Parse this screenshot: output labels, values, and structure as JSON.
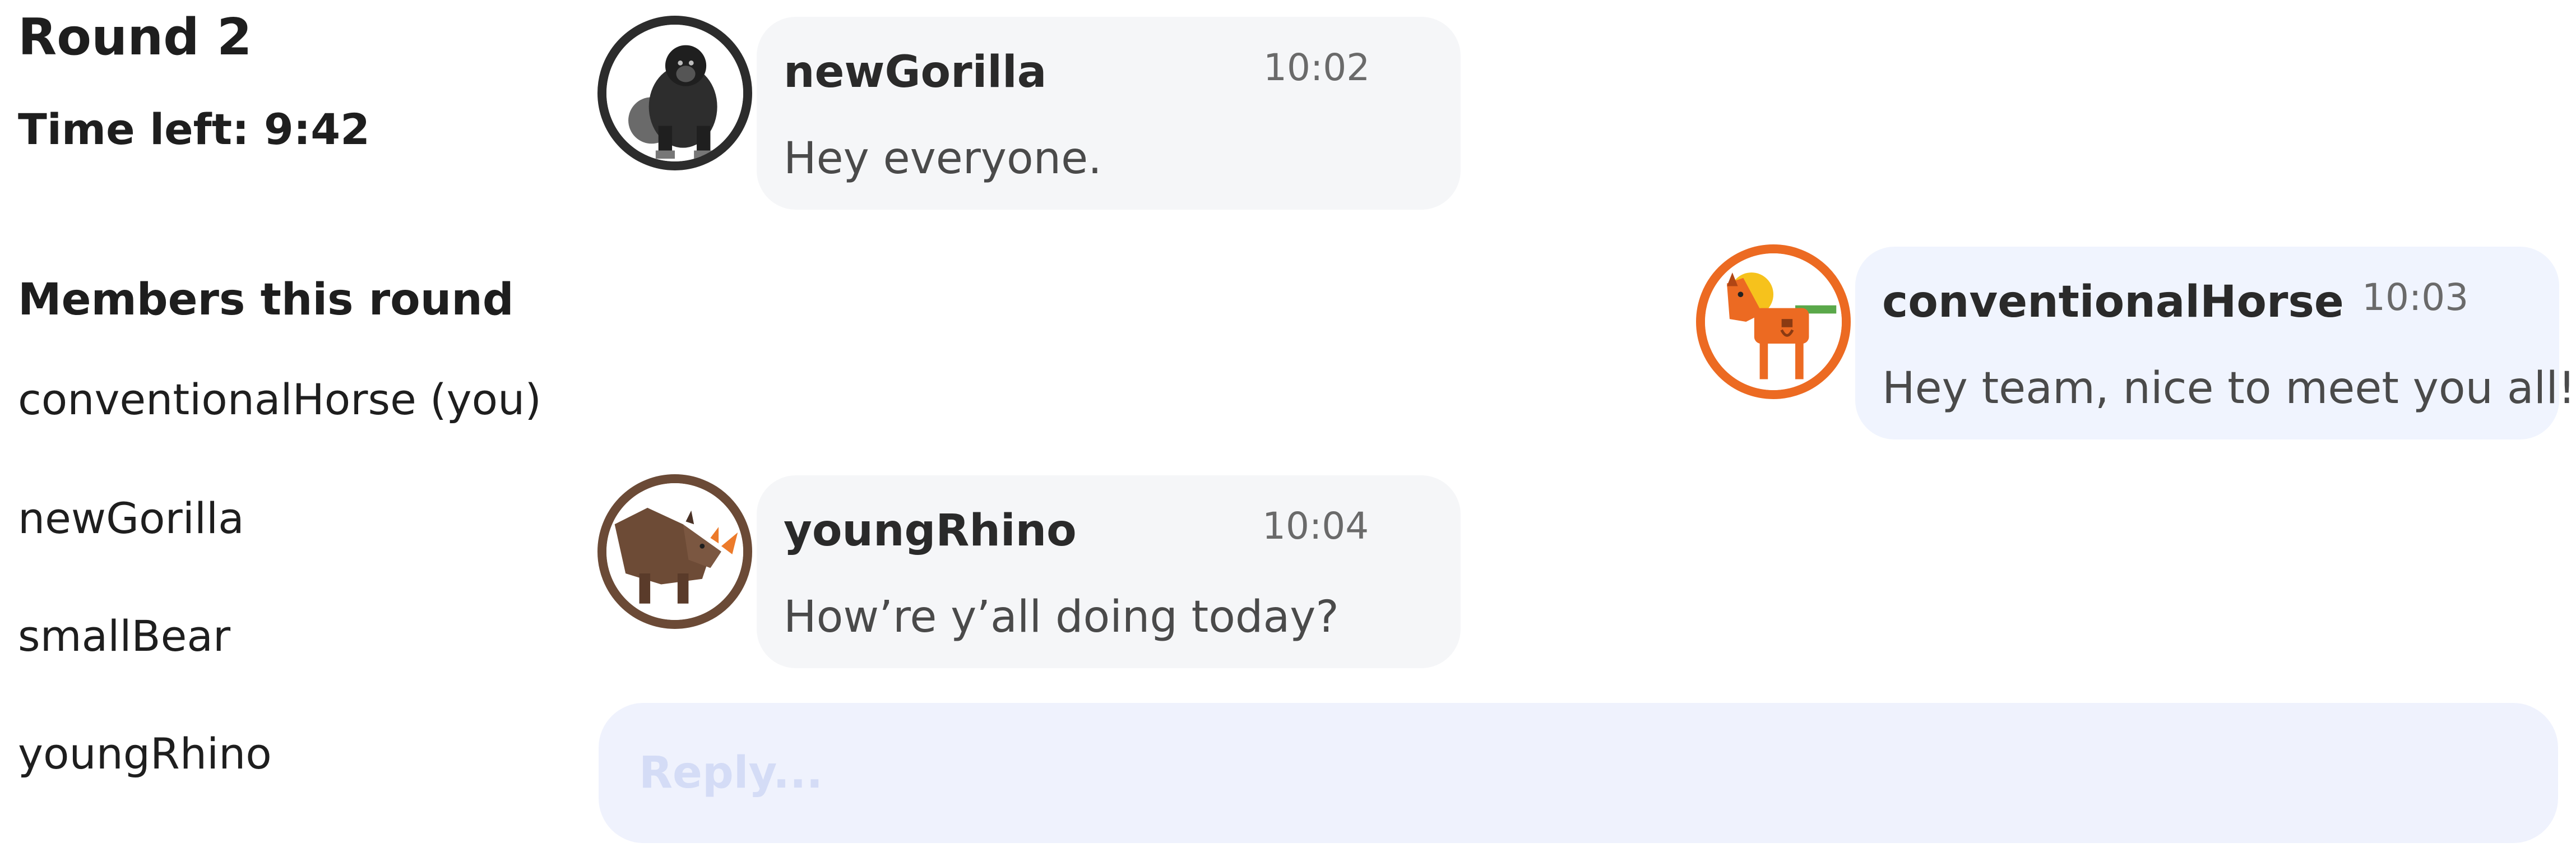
{
  "round": {
    "title": "Round 2",
    "time_left": "Time left: 9:42"
  },
  "members": {
    "heading": "Members this round",
    "items": [
      {
        "label": "conventionalHorse (you)"
      },
      {
        "label": "newGorilla"
      },
      {
        "label": "smallBear"
      },
      {
        "label": "youngRhino"
      }
    ]
  },
  "messages": [
    {
      "sender": "newGorilla",
      "time": "10:02",
      "text": "Hey everyone.",
      "avatar_icon": "gorilla-avatar-icon",
      "ring_color": "#2c2c2c",
      "mine": false
    },
    {
      "sender": "conventionalHorse",
      "time": "10:03",
      "text": "Hey team, nice to meet you all!",
      "avatar_icon": "horse-avatar-icon",
      "ring_color": "#ec6a22",
      "mine": true
    },
    {
      "sender": "youngRhino",
      "time": "10:04",
      "text": "How’re y’all doing today?",
      "avatar_icon": "rhino-avatar-icon",
      "ring_color": "#6b4a36",
      "mine": false
    }
  ],
  "reply": {
    "placeholder": "Reply..."
  },
  "colors": {
    "other_bubble": "#f5f6f8",
    "my_bubble": "#f0f4fe",
    "reply_field": "#eff2fd",
    "text_dark": "#1e1e1e"
  }
}
